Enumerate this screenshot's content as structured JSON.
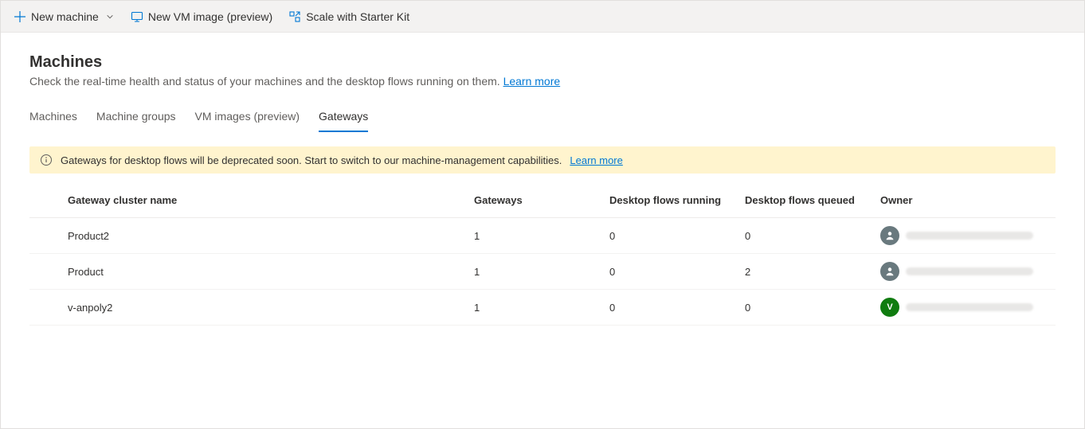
{
  "commandBar": {
    "newMachine": "New machine",
    "newVmImage": "New VM image (preview)",
    "scaleStarterKit": "Scale with Starter Kit"
  },
  "header": {
    "title": "Machines",
    "description": "Check the real-time health and status of your machines and the desktop flows running on them.",
    "learnMore": "Learn more"
  },
  "tabs": {
    "machines": "Machines",
    "machineGroups": "Machine groups",
    "vmImages": "VM images (preview)",
    "gateways": "Gateways",
    "active": "gateways"
  },
  "banner": {
    "text": "Gateways for desktop flows will be deprecated soon. Start to switch to our machine-management capabilities.",
    "learnMore": "Learn more"
  },
  "table": {
    "columns": {
      "name": "Gateway cluster name",
      "gateways": "Gateways",
      "running": "Desktop flows running",
      "queued": "Desktop flows queued",
      "owner": "Owner"
    },
    "rows": [
      {
        "name": "Product2",
        "gateways": "1",
        "running": "0",
        "queued": "0",
        "ownerType": "person",
        "ownerInitial": ""
      },
      {
        "name": "Product",
        "gateways": "1",
        "running": "0",
        "queued": "2",
        "ownerType": "person",
        "ownerInitial": ""
      },
      {
        "name": "v-anpoly2",
        "gateways": "1",
        "running": "0",
        "queued": "0",
        "ownerType": "green",
        "ownerInitial": "V"
      }
    ]
  }
}
